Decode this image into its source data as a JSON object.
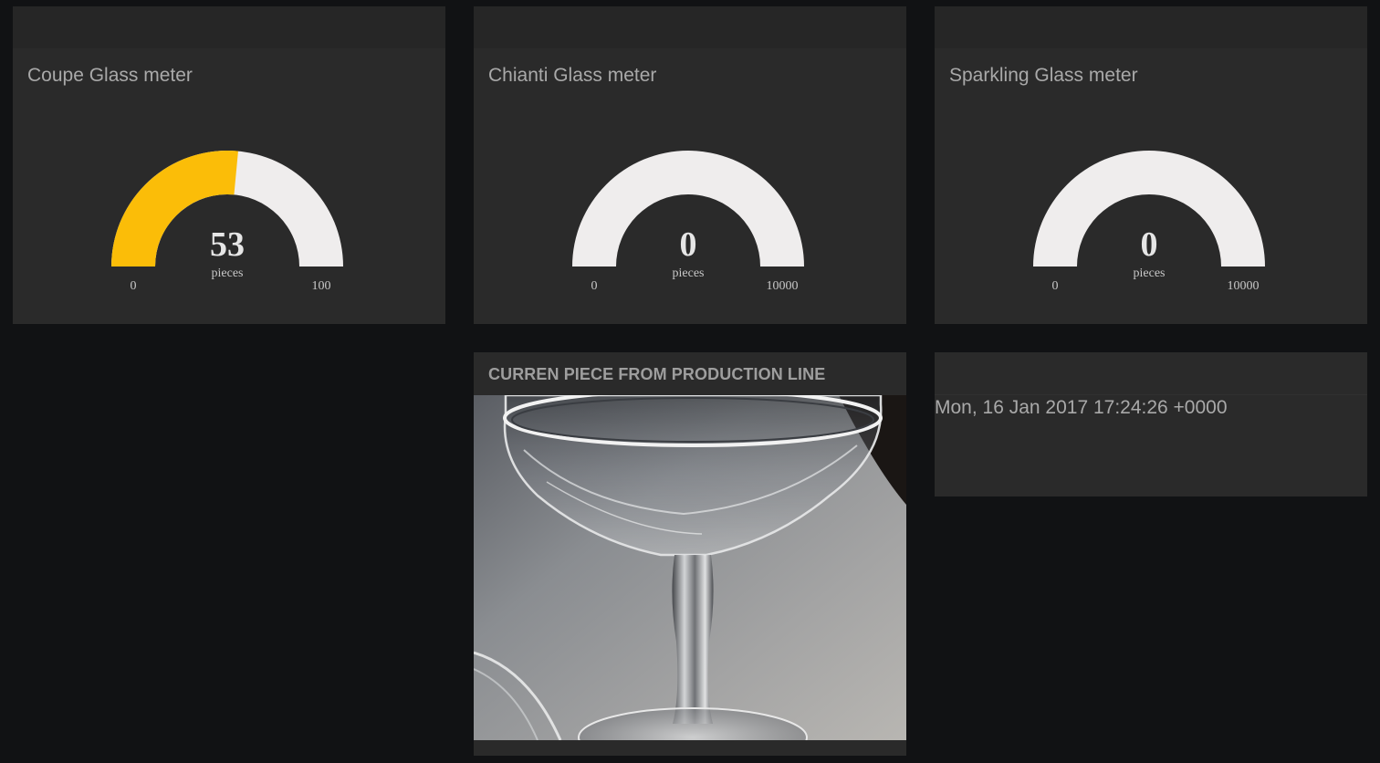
{
  "gauges": [
    {
      "title": "Coupe Glass meter",
      "value": 53,
      "value_label": "53",
      "unit": "pieces",
      "min": 0,
      "max": 100,
      "min_label": "0",
      "max_label": "100",
      "fill_color": "#fbbd08",
      "track_color": "#efeded"
    },
    {
      "title": "Chianti Glass meter",
      "value": 0,
      "value_label": "0",
      "unit": "pieces",
      "min": 0,
      "max": 10000,
      "min_label": "0",
      "max_label": "10000",
      "fill_color": "#fbbd08",
      "track_color": "#efeded"
    },
    {
      "title": "Sparkling Glass meter",
      "value": 0,
      "value_label": "0",
      "unit": "pieces",
      "min": 0,
      "max": 10000,
      "min_label": "0",
      "max_label": "10000",
      "fill_color": "#fbbd08",
      "track_color": "#efeded"
    }
  ],
  "image_panel": {
    "title": "CURREN PIECE FROM PRODUCTION LINE",
    "image_subject": "coupe-glass-photo"
  },
  "timestamp_panel": {
    "text": "Mon, 16 Jan 2017 17:24:26 +0000"
  },
  "colors": {
    "background": "#111214",
    "panel": "#2a2a2a",
    "gauge_fill": "#fbbd08",
    "gauge_track": "#efeded"
  }
}
